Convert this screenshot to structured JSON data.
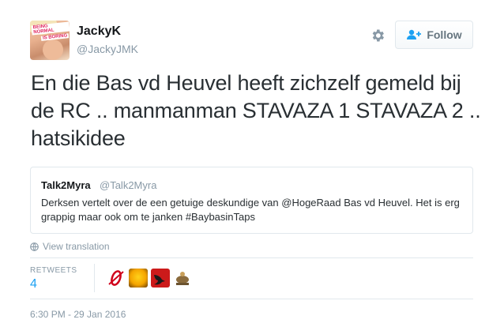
{
  "author": {
    "name": "JackyK",
    "handle": "@JackyJMK",
    "avatar_text_1": "BEING NORMAL",
    "avatar_text_2": "IS BORING"
  },
  "actions": {
    "settings_icon": "gear-icon",
    "follow_label": "Follow",
    "follow_icon": "add-user-icon"
  },
  "tweet": {
    "text": "En die Bas vd Heuvel heeft zichzelf gemeld bij de RC .. manmanman STAVAZA 1 STAVAZA 2 .. hatsikidee"
  },
  "quoted_tweet": {
    "name": "Talk2Myra",
    "handle": "@Talk2Myra",
    "text": "Derksen vertelt over de een getuige deskundige van @HogeRaad Bas vd Heuvel. Het is erg grappig maar ook om te janken #BaybasinTaps"
  },
  "translation": {
    "label": "View translation",
    "icon": "globe-icon"
  },
  "stats": {
    "retweets_label": "RETWEETS",
    "retweets_count": "4"
  },
  "timestamp": "6:30 PM - 29 Jan 2016",
  "colors": {
    "accent": "#1da1f2",
    "muted": "#8899a6",
    "text": "#292f33",
    "border": "#e1e8ed"
  }
}
